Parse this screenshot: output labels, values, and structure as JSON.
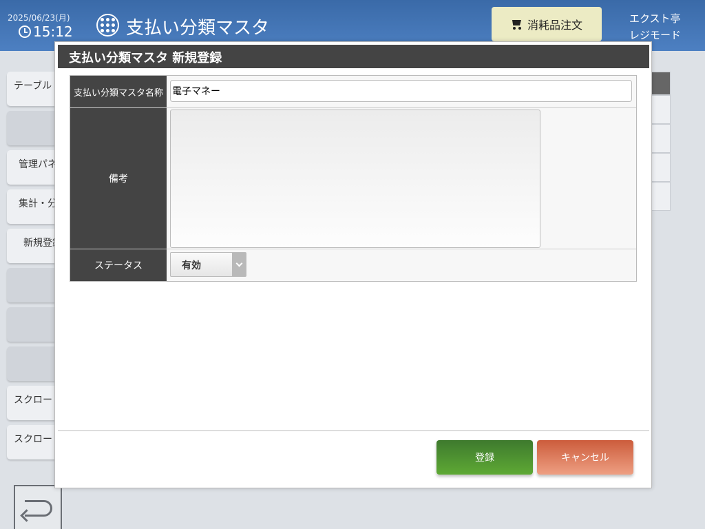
{
  "header": {
    "date": "2025/06/23(月)",
    "time": "15:12",
    "title": "支払い分類マスタ",
    "order_button": "消耗品注文",
    "shop_name": "エクスト亭",
    "mode": "レジモード"
  },
  "side_menu": {
    "items": [
      "テーブル",
      "",
      "管理パネ",
      "集計・分",
      "新規登録",
      "",
      "",
      "",
      "スクロー",
      "スクロー"
    ]
  },
  "modal": {
    "title": "支払い分類マスタ 新規登録",
    "name_label": "支払い分類マスタ名称",
    "name_value": "電子マネー",
    "memo_label": "備考",
    "memo_value": "",
    "status_label": "ステータス",
    "status_value": "有効",
    "register_button": "登録",
    "cancel_button": "キャンセル"
  },
  "colors": {
    "header": "#4573b5",
    "modal_title": "#444444",
    "register": "#4e9330",
    "cancel": "#e07d5e",
    "order_button": "#ecebc4"
  }
}
